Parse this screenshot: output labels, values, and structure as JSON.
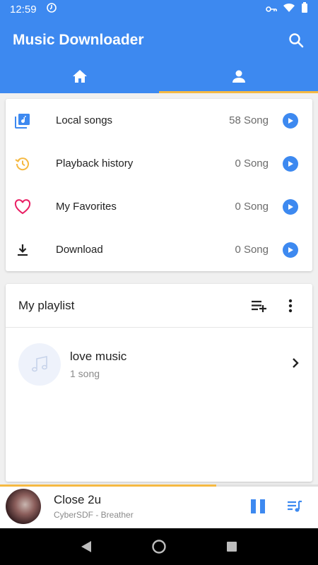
{
  "status_bar": {
    "time": "12:59"
  },
  "app_bar": {
    "title": "Music Downloader"
  },
  "tabs": [
    {
      "icon": "home-icon",
      "active": false
    },
    {
      "icon": "person-icon",
      "active": true
    }
  ],
  "library": [
    {
      "label": "Local songs",
      "count": "58 Song",
      "icon": "music-library-icon",
      "color": "#3d89f0"
    },
    {
      "label": "Playback history",
      "count": "0 Song",
      "icon": "history-icon",
      "color": "#f5b942"
    },
    {
      "label": "My Favorites",
      "count": "0 Song",
      "icon": "heart-icon",
      "color": "#e91e63"
    },
    {
      "label": "Download",
      "count": "0 Song",
      "icon": "download-icon",
      "color": "#212121"
    }
  ],
  "playlist": {
    "title": "My playlist",
    "items": [
      {
        "name": "love music",
        "count": "1 song"
      }
    ]
  },
  "now_playing": {
    "title": "Close 2u",
    "subtitle": "CyberSDF - Breather",
    "progress": 0.68
  },
  "colors": {
    "accent": "#3d89f0",
    "highlight": "#f5b942"
  }
}
